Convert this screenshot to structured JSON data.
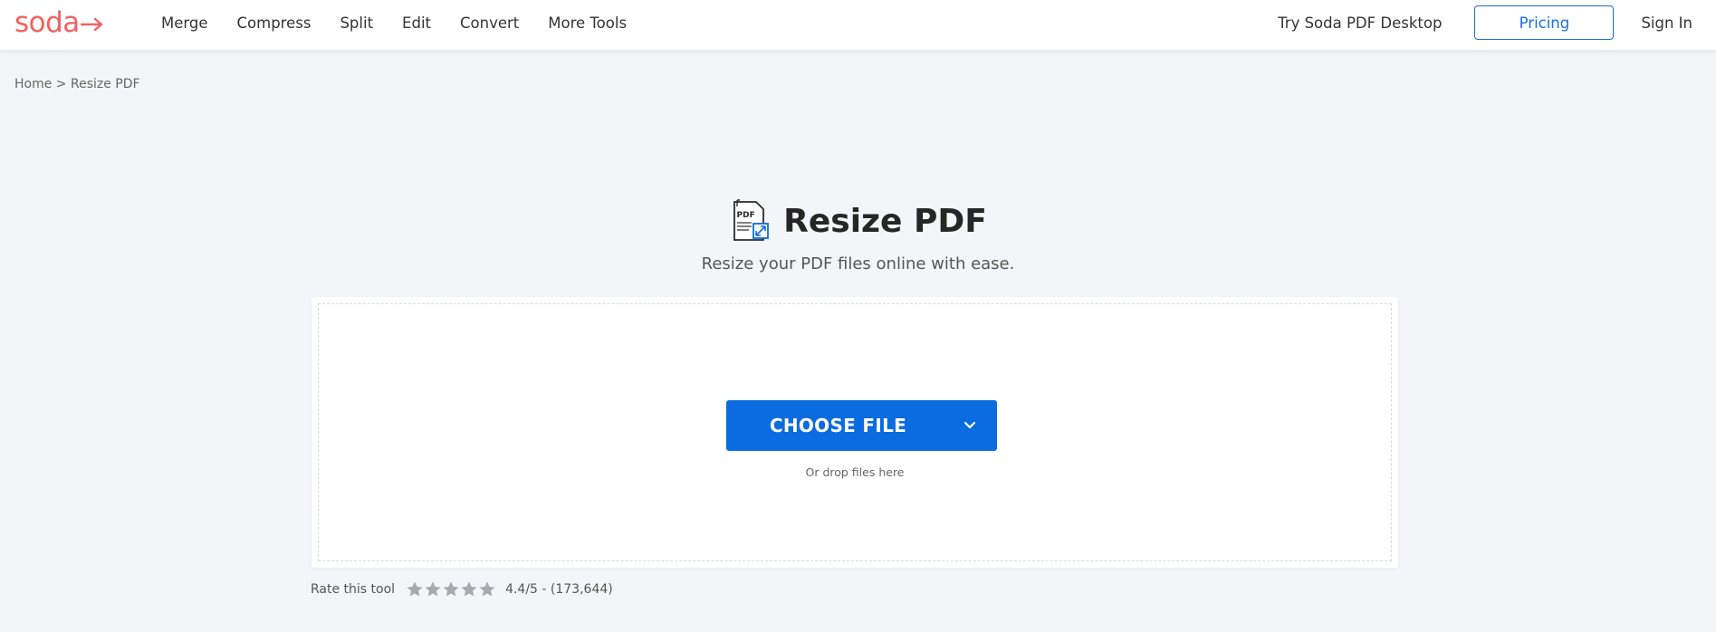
{
  "header": {
    "logo": "soda",
    "nav": [
      "Merge",
      "Compress",
      "Split",
      "Edit",
      "Convert",
      "More Tools"
    ],
    "try_desktop": "Try Soda PDF Desktop",
    "pricing": "Pricing",
    "sign_in": "Sign In"
  },
  "breadcrumb": {
    "home": "Home",
    "separator": ">",
    "current": "Resize PDF"
  },
  "main": {
    "title": "Resize PDF",
    "subtitle": "Resize your PDF files online with ease.",
    "pdf_icon_text": "PDF",
    "choose_file": "CHOOSE FILE",
    "drop_hint": "Or drop files here"
  },
  "rating": {
    "label": "Rate this tool",
    "score_text": "4.4/5 - (173,644)",
    "stars_total": 5,
    "star_color": "#a7a9ae"
  },
  "colors": {
    "brand": "#f06163",
    "primary": "#0b6be0",
    "background": "#f4f5f8"
  }
}
